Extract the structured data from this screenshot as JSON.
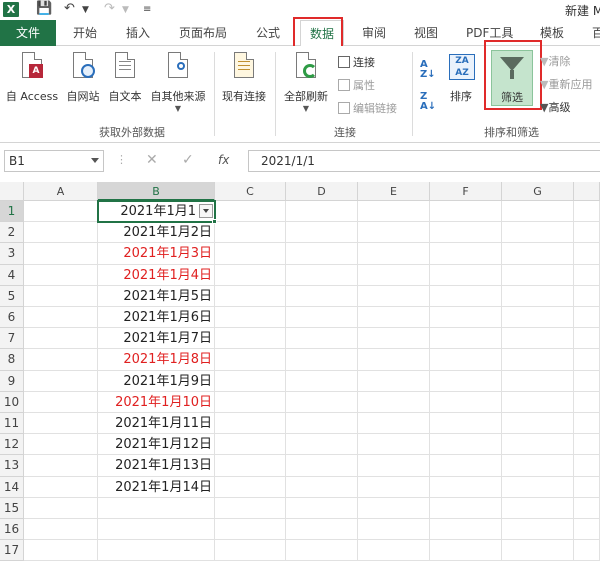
{
  "title": {
    "doc": "新建 M",
    "xl": "X"
  },
  "tabs": [
    "文件",
    "开始",
    "插入",
    "页面布局",
    "公式",
    "数据",
    "审阅",
    "视图",
    "PDF工具",
    "模板",
    "百"
  ],
  "ribbon": {
    "ext": {
      "access": "自 Access",
      "web": "自网站",
      "text": "自文本",
      "other": "自其他来源",
      "existing": "现有连接",
      "label": "获取外部数据"
    },
    "conn": {
      "refresh": "全部刷新",
      "connections": "连接",
      "properties": "属性",
      "edit_links": "编辑链接",
      "label": "连接"
    },
    "sort": {
      "sort": "排序",
      "filter": "筛选",
      "clear": "清除",
      "reapply": "重新应用",
      "advanced": "高级",
      "label": "排序和筛选"
    }
  },
  "namebox": "B1",
  "fx": "fx",
  "formula": "2021/1/1",
  "columns": [
    "A",
    "B",
    "C",
    "D",
    "E",
    "F",
    "G"
  ],
  "rows": [
    "1",
    "2",
    "3",
    "4",
    "5",
    "6",
    "7",
    "8",
    "9",
    "10",
    "11",
    "12",
    "13",
    "14",
    "15",
    "16",
    "17"
  ],
  "cells": [
    {
      "v": "2021年1月1",
      "red": false
    },
    {
      "v": "2021年1月2日",
      "red": false
    },
    {
      "v": "2021年1月3日",
      "red": true
    },
    {
      "v": "2021年1月4日",
      "red": true
    },
    {
      "v": "2021年1月5日",
      "red": false
    },
    {
      "v": "2021年1月6日",
      "red": false
    },
    {
      "v": "2021年1月7日",
      "red": false
    },
    {
      "v": "2021年1月8日",
      "red": true
    },
    {
      "v": "2021年1月9日",
      "red": false
    },
    {
      "v": "2021年1月10日",
      "red": true
    },
    {
      "v": "2021年1月11日",
      "red": false
    },
    {
      "v": "2021年1月12日",
      "red": false
    },
    {
      "v": "2021年1月13日",
      "red": false
    },
    {
      "v": "2021年1月14日",
      "red": false
    }
  ],
  "colors": {
    "accent": "#217346",
    "red_text": "#e02020",
    "highlight": "#e02a2a"
  }
}
